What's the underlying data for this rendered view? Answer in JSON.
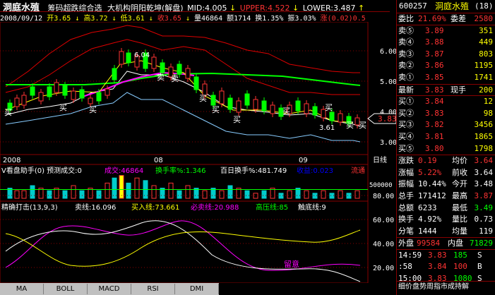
{
  "topbar": {
    "title": "洞庭水殖",
    "indicator_name": "筹码超跌综合选",
    "indicator2_name": "大机构阴阳乾坤(解盘)",
    "mid_label": "MID:4.005",
    "upper_label": "UPPER:4.522",
    "lower_label": "LOWER:3.487",
    "up_arrow": "↑",
    "down_arrow": "↓"
  },
  "infobar": {
    "date": "2008/09/12",
    "open": "开3.65",
    "high": "高3.72",
    "low": "低3.61",
    "close": "收3.65",
    "volume": "量46864",
    "amount": "额1714",
    "turnover": "换1.35%",
    "amplitude": "振3.03%",
    "change": "涨(0.02)0.5"
  },
  "price_pane": {
    "y_labels": [
      "6.00",
      "5.00",
      "4.00",
      "3.00"
    ],
    "current_price": "3.83",
    "buy_marks": [
      "买",
      "买",
      "买",
      "买",
      "买",
      "买",
      "买",
      "买",
      "买",
      "买"
    ],
    "sell_marks": [
      "卖",
      "卖"
    ],
    "low_marker": "3.61",
    "high_marker": "6.04"
  },
  "date_axis": {
    "labels": [
      "2008",
      "08",
      "09"
    ],
    "right_label": "日线"
  },
  "volume_pane": {
    "title": "V看盘助手(0) 预测成交:0",
    "chengjiao": "成交:46864",
    "huanshou": "换手率%:1.346",
    "baiday": "百日换手%:481.749",
    "shouyi": "收益:0.023",
    "liutong": "流通",
    "y_label": "500000"
  },
  "signal_pane": {
    "title": "精确打击(13,9,3)",
    "sell_line": "卖线:16.096",
    "buy_line": "买入线:73.661",
    "must_sell": "必卖线:20.988",
    "high_press": "高压线:85",
    "bottom_line": "触底线:9",
    "y_labels": [
      "80.00",
      "60.00",
      "40.00",
      "20.00"
    ],
    "note": "留意"
  },
  "bottom_tabs": [
    "MA",
    "BOLL",
    "MACD",
    "RSI",
    "DMI"
  ],
  "right_panel": {
    "code": "600257",
    "name": "洞庭水殖",
    "count": "(18)",
    "weibi_label": "委比",
    "weibi": "21.69%",
    "weicha_label": "委差",
    "weicha": "2580",
    "sell": [
      {
        "label": "卖⑤",
        "price": "3.89",
        "vol": "351"
      },
      {
        "label": "卖④",
        "price": "3.88",
        "vol": "449"
      },
      {
        "label": "卖③",
        "price": "3.87",
        "vol": "803"
      },
      {
        "label": "卖②",
        "price": "3.86",
        "vol": "1195"
      },
      {
        "label": "卖①",
        "price": "3.85",
        "vol": "1741"
      }
    ],
    "latest_label": "最新",
    "latest": "3.83",
    "xianshou_label": "现手",
    "xianshou": "200",
    "buy": [
      {
        "label": "买①",
        "price": "3.84",
        "vol": "12"
      },
      {
        "label": "买②",
        "price": "3.83",
        "vol": "98"
      },
      {
        "label": "买③",
        "price": "3.82",
        "vol": "3456"
      },
      {
        "label": "买④",
        "price": "3.81",
        "vol": "1865"
      },
      {
        "label": "买⑤",
        "price": "3.80",
        "vol": "1798"
      }
    ],
    "stats": [
      {
        "l1": "涨跌",
        "v1": "0.19",
        "l2": "均价",
        "v2": "3.64"
      },
      {
        "l1": "涨幅",
        "v1": "5.22%",
        "l2": "前收",
        "v2": "3.64"
      },
      {
        "l1": "振幅",
        "v1": "10.44%",
        "l2": "今开",
        "v2": "3.48"
      },
      {
        "l1": "总手",
        "v1": "171412",
        "l2": "最高",
        "v2": "3.87"
      },
      {
        "l1": "总额",
        "v1": "6233",
        "l2": "最低",
        "v2": "3.49"
      },
      {
        "l1": "换手",
        "v1": "4.92%",
        "l2": "量比",
        "v2": "0.73"
      },
      {
        "l1": "分笔",
        "v1": "1444",
        "l2": "均量",
        "v2": "119"
      }
    ],
    "waipan_label": "外盘",
    "waipan": "99584",
    "neipan_label": "内盘",
    "neipan": "71829",
    "ticks": [
      {
        "time": "14:59",
        "price": "3.83",
        "vol": "185",
        "dir": "S"
      },
      {
        "time": ":58",
        "price": "3.84",
        "vol": "100",
        "dir": "B"
      },
      {
        "time": "15:00",
        "price": "3.83",
        "vol": "1080",
        "dir": "S"
      }
    ],
    "footer": "细价盘势周指市成持解"
  }
}
